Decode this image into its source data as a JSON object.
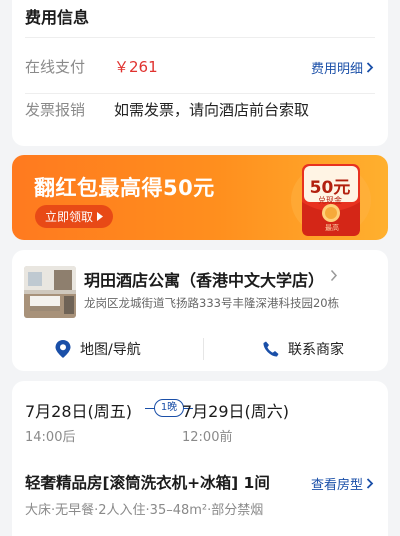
{
  "fee": {
    "title": "费用信息",
    "online_label": "在线支付",
    "price": "￥261",
    "detail_link": "费用明细",
    "invoice_label": "发票报销",
    "invoice_value": "如需发票，请向酒店前台索取"
  },
  "banner": {
    "title": "翻红包最高得50元",
    "button": "立即领取",
    "envelope_amount": "50元",
    "envelope_sub": "兑现金",
    "envelope_max": "最高"
  },
  "hotel": {
    "name": "玥田酒店公寓（香港中文大学店）",
    "address": "龙岗区龙城街道飞扬路333号丰隆深港科技园20栋",
    "map_label": "地图/导航",
    "contact_label": "联系商家"
  },
  "booking": {
    "checkin_date": "7月28日(周五)",
    "checkin_time": "14:00后",
    "nights": "1晚",
    "checkout_date": "7月29日(周六)",
    "checkout_time": "12:00前",
    "room_title": "轻奢精品房[滚筒洗衣机+冰箱] 1间",
    "room_link": "查看房型",
    "room_info": "大床·无早餐·2人入住·35–48m²·部分禁烟"
  },
  "colors": {
    "accent_blue": "#1a4fa8",
    "price_red": "#e0322f",
    "banner_orange": "#ff8f1e"
  },
  "icons": [
    "chevron-right-icon",
    "map-pin-icon",
    "phone-icon",
    "red-envelope-icon"
  ]
}
